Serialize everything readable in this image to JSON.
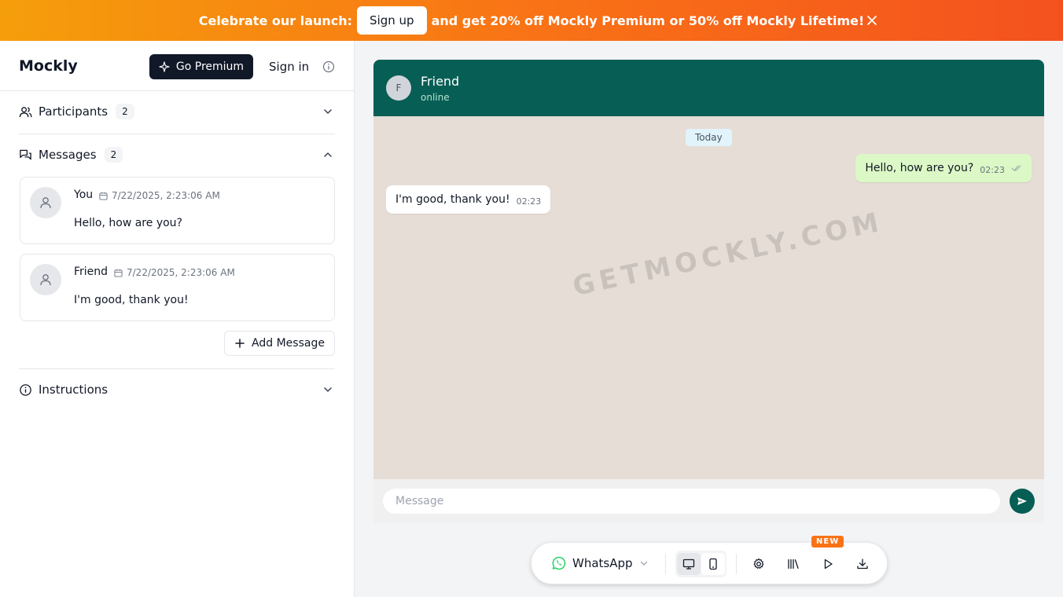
{
  "banner": {
    "prefix": "Celebrate our launch:",
    "signup_label": "Sign up",
    "suffix": "and get 20% off Mockly Premium or 50% off Mockly Lifetime!"
  },
  "sidebar": {
    "logo": "Mockly",
    "premium_label": "Go Premium",
    "signin_label": "Sign in",
    "participants": {
      "label": "Participants",
      "count": "2"
    },
    "messages": {
      "label": "Messages",
      "count": "2",
      "items": [
        {
          "sender": "You",
          "date": "7/22/2025, 2:23:06 AM",
          "text": "Hello, how are you?"
        },
        {
          "sender": "Friend",
          "date": "7/22/2025, 2:23:06 AM",
          "text": "I'm good, thank you!"
        }
      ],
      "add_label": "Add Message"
    },
    "instructions": {
      "label": "Instructions"
    }
  },
  "chat": {
    "contact_initial": "F",
    "contact_name": "Friend",
    "contact_status": "online",
    "date_divider": "Today",
    "messages": [
      {
        "direction": "out",
        "text": "Hello, how are you?",
        "time": "02:23"
      },
      {
        "direction": "in",
        "text": "I'm good, thank you!",
        "time": "02:23"
      }
    ],
    "watermark": "GETMOCKLY.COM",
    "composer_placeholder": "Message"
  },
  "toolbar": {
    "platform": "WhatsApp",
    "new_badge": "NEW",
    "icons": [
      "whatsapp-icon",
      "desktop-icon",
      "mobile-icon",
      "settings-icon",
      "library-icon",
      "play-icon",
      "download-icon"
    ]
  },
  "colors": {
    "banner_start": "#f59e0b",
    "banner_end": "#f4511e",
    "chat_header": "#075e54",
    "chat_bg": "#e5ddd6",
    "outgoing_bubble": "#dcf8c6",
    "whatsapp_green": "#25d366"
  }
}
